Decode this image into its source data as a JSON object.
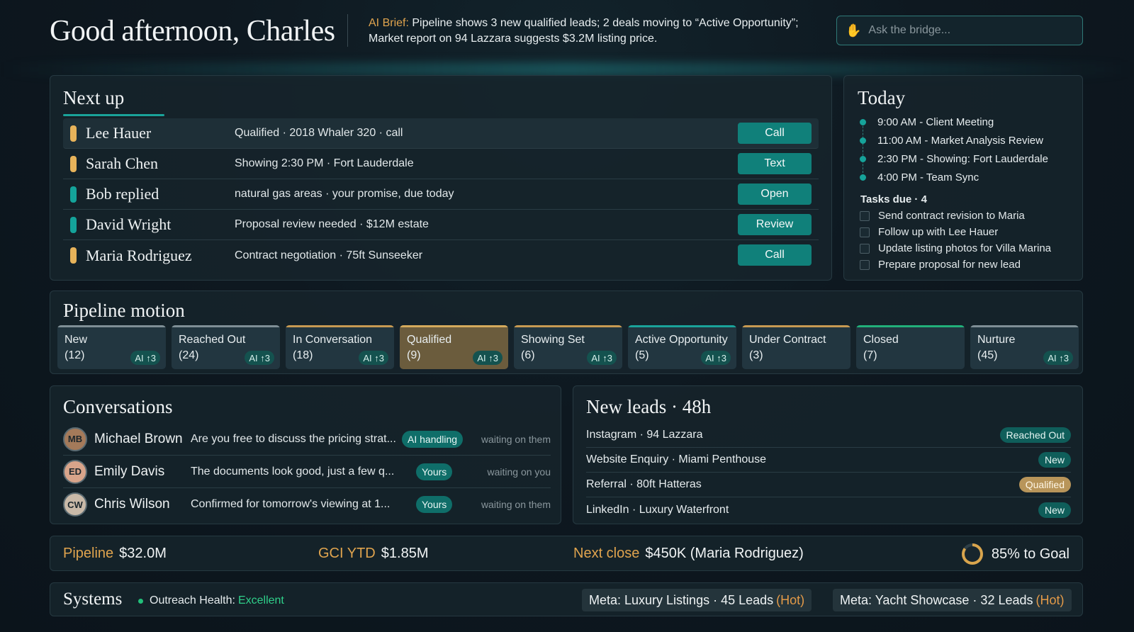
{
  "header": {
    "greeting": "Good afternoon, Charles",
    "brief_label": "AI Brief:",
    "brief_text": " Pipeline shows 3 new qualified leads; 2 deals moving to “Active Opportunity”; Market report on 94 Lazzara suggests $3.2M listing price.",
    "ask_placeholder": "Ask the bridge...",
    "ask_icon": "waving-hand-icon"
  },
  "next_up": {
    "title": "Next up",
    "items": [
      {
        "name": "Lee Hauer",
        "desc": "Qualified · 2018 Whaler 320 · call",
        "action": "Call",
        "color": "#e7b35a"
      },
      {
        "name": "Sarah Chen",
        "desc": "Showing 2:30 PM · Fort Lauderdale",
        "action": "Text",
        "color": "#e7b35a"
      },
      {
        "name": "Bob replied",
        "desc": "natural gas areas · your promise, due today",
        "action": "Open",
        "color": "#14a39a"
      },
      {
        "name": "David Wright",
        "desc": "Proposal review needed · $12M estate",
        "action": "Review",
        "color": "#14a39a"
      },
      {
        "name": "Maria Rodriguez",
        "desc": "Contract negotiation · 75ft Sunseeker",
        "action": "Call",
        "color": "#e7b35a"
      }
    ]
  },
  "today": {
    "title": "Today",
    "schedule": [
      "9:00 AM - Client Meeting",
      "11:00 AM - Market Analysis Review",
      "2:30 PM - Showing: Fort Lauderdale",
      "4:00 PM - Team Sync"
    ],
    "tasks_title": "Tasks due · 4",
    "tasks": [
      "Send contract revision to Maria",
      "Follow up with Lee Hauer",
      "Update listing photos for Villa Marina",
      "Prepare proposal for new lead"
    ]
  },
  "pipeline": {
    "title": "Pipeline motion",
    "stages": [
      {
        "label": "New",
        "count": "(12)",
        "ai": "AI ↑3",
        "accent": "#7f8f96"
      },
      {
        "label": "Reached Out",
        "count": "(24)",
        "ai": "AI ↑3",
        "accent": "#7f8f96"
      },
      {
        "label": "In Conversation",
        "count": "(18)",
        "ai": "AI ↑3",
        "accent": "#c79a52"
      },
      {
        "label": "Qualified",
        "count": "(9)",
        "ai": "AI ↑3",
        "accent": "#d4aa5c"
      },
      {
        "label": "Showing Set",
        "count": "(6)",
        "ai": "AI ↑3",
        "accent": "#c79a52"
      },
      {
        "label": "Active Opportunity",
        "count": "(5)",
        "ai": "AI ↑3",
        "accent": "#1aa39a"
      },
      {
        "label": "Under Contract",
        "count": "(3)",
        "ai": "",
        "accent": "#c79a52"
      },
      {
        "label": "Closed",
        "count": "(7)",
        "ai": "",
        "accent": "#22b07a"
      },
      {
        "label": "Nurture",
        "count": "(45)",
        "ai": "AI ↑3",
        "accent": "#7f8f96"
      }
    ]
  },
  "conversations": {
    "title": "Conversations",
    "items": [
      {
        "name": "Michael Brown",
        "initials": "MB",
        "avatar_color": "#a47a5a",
        "message": "Are you free to discuss the pricing strat...",
        "tag": "AI handling",
        "status": "waiting on them"
      },
      {
        "name": "Emily Davis",
        "initials": "ED",
        "avatar_color": "#d8a48a",
        "message": "The documents look good, just a few q...",
        "tag": "Yours",
        "status": "waiting on you"
      },
      {
        "name": "Chris Wilson",
        "initials": "CW",
        "avatar_color": "#c9b9a8",
        "message": "Confirmed for tomorrow's viewing at 1...",
        "tag": "Yours",
        "status": "waiting on them"
      }
    ]
  },
  "new_leads": {
    "title": "New leads · 48h",
    "items": [
      {
        "text": "Instagram · 94 Lazzara",
        "status": "Reached Out"
      },
      {
        "text": "Website Enquiry · Miami Penthouse",
        "status": "New"
      },
      {
        "text": "Referral · 80ft Hatteras",
        "status": "Qualified"
      },
      {
        "text": "LinkedIn · Luxury Waterfront",
        "status": "New"
      }
    ]
  },
  "stats": {
    "pipeline_label": "Pipeline",
    "pipeline_value": "$32.0M",
    "gci_label": "GCI YTD",
    "gci_value": "$1.85M",
    "next_close_label": "Next close",
    "next_close_value": "$450K (Maria Rodriguez)",
    "goal_text": "85% to Goal",
    "goal_fraction": 0.85
  },
  "systems": {
    "title": "Systems",
    "health_label": "Outreach Health:",
    "health_value": "Excellent",
    "campaigns": [
      {
        "label": "Meta: Luxury Listings · 45 Leads",
        "hot": "(Hot)"
      },
      {
        "label": "Meta: Yacht Showcase · 32 Leads",
        "hot": "(Hot)"
      }
    ]
  }
}
